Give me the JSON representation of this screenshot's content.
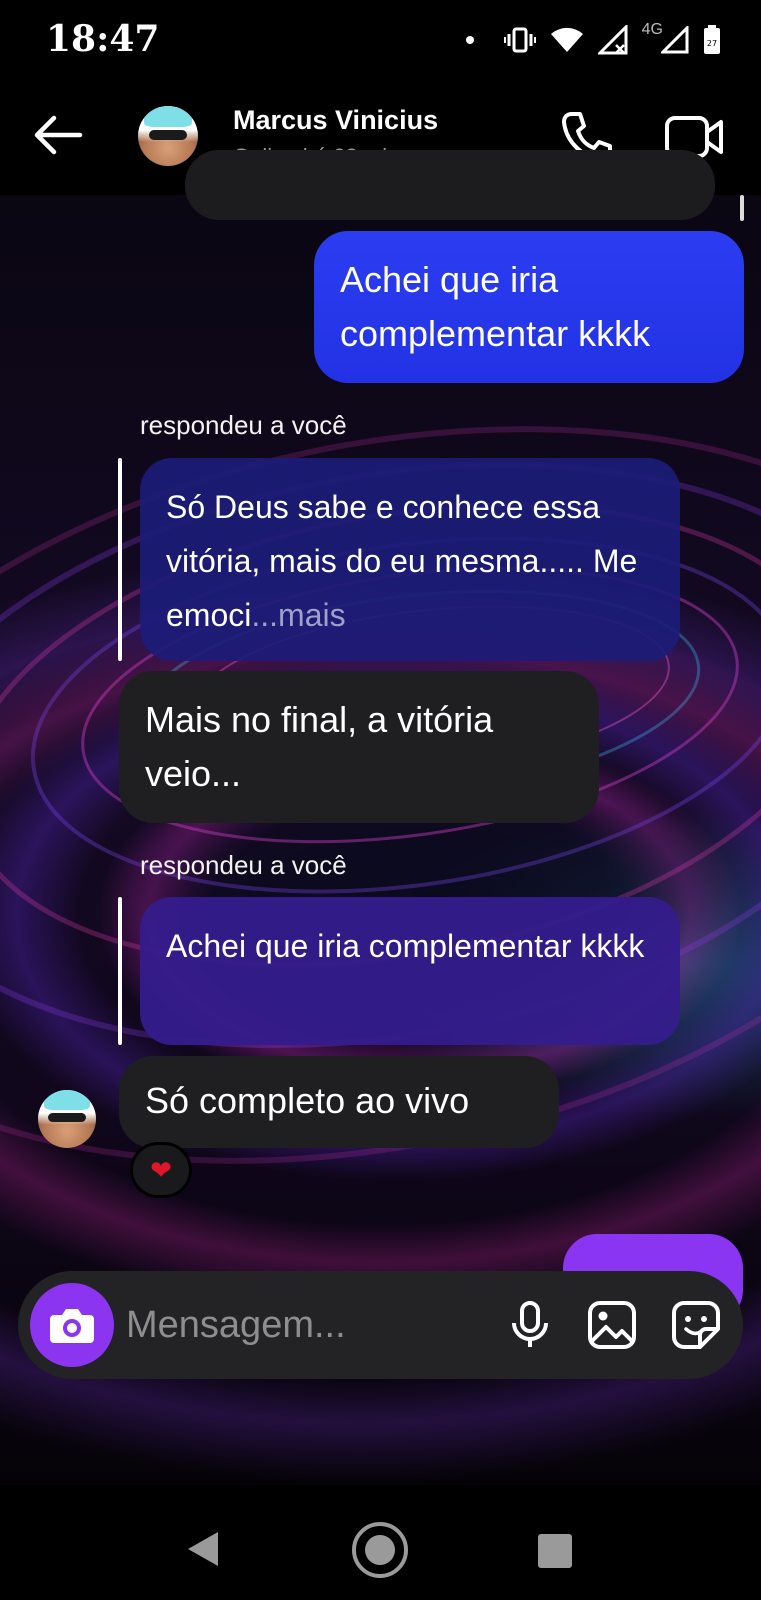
{
  "status_bar": {
    "time": "18:47",
    "network": "4G",
    "icons": [
      "dot-icon",
      "vibrate-icon",
      "wifi-icon",
      "signal-no-data-icon",
      "signal-icon",
      "battery-icon"
    ],
    "battery_level": "27"
  },
  "header": {
    "contact_name": "Marcus Vinicius",
    "contact_status": "Online há 23 min",
    "icons": [
      "back-arrow-icon",
      "phone-icon",
      "video-camera-icon"
    ]
  },
  "messages": {
    "sent_1": "Achei que iria complementar kkkk",
    "reply_label_1": "respondeu a você",
    "quoted_1_text": "Só Deus sabe e conhece essa vitória, mais do eu mesma..... Me emoci",
    "quoted_1_more": "...mais",
    "received_1": "Mais no final, a vitória veio...",
    "reply_label_2": "respondeu a você",
    "quoted_2_text": "Achei que iria complementar kkkk",
    "received_2": "Só completo ao vivo",
    "reaction": "❤"
  },
  "composer": {
    "placeholder": "Mensagem...",
    "icons": [
      "camera-icon",
      "microphone-icon",
      "gallery-icon",
      "sticker-icon"
    ]
  },
  "nav_bar": {
    "icons": [
      "nav-back-icon",
      "nav-home-icon",
      "nav-recents-icon"
    ]
  },
  "colors": {
    "sent_bubble": "#2c3cf1",
    "received_bubble": "#1f1f22",
    "camera_button": "#8b35f0",
    "quoted_1_bg": "#1c1c78",
    "quoted_2_bg": "#341c8c"
  }
}
